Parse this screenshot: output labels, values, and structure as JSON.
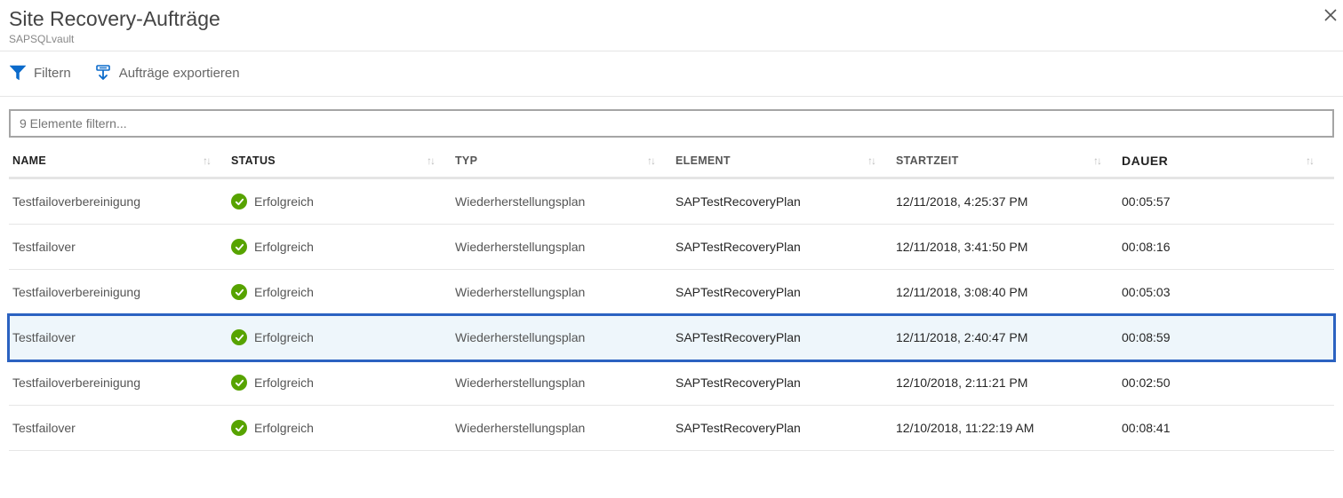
{
  "header": {
    "title": "Site Recovery-Aufträge",
    "subtitle": "SAPSQLvault"
  },
  "toolbar": {
    "filter_label": "Filtern",
    "export_label": "Aufträge exportieren"
  },
  "filter": {
    "placeholder": "9 Elemente filtern..."
  },
  "columns": {
    "name": "NAME",
    "status": "STATUS",
    "typ": "TYP",
    "element": "ELEMENT",
    "start": "STARTZEIT",
    "dauer": "DAUER"
  },
  "rows": [
    {
      "name": "Testfailoverbereinigung",
      "status": "Erfolgreich",
      "typ": "Wiederherstellungsplan",
      "element": "SAPTestRecoveryPlan",
      "start": "12/11/2018, 4:25:37 PM",
      "dauer": "00:05:57",
      "selected": false
    },
    {
      "name": "Testfailover",
      "status": "Erfolgreich",
      "typ": "Wiederherstellungsplan",
      "element": "SAPTestRecoveryPlan",
      "start": "12/11/2018, 3:41:50 PM",
      "dauer": "00:08:16",
      "selected": false
    },
    {
      "name": "Testfailoverbereinigung",
      "status": "Erfolgreich",
      "typ": "Wiederherstellungsplan",
      "element": "SAPTestRecoveryPlan",
      "start": "12/11/2018, 3:08:40 PM",
      "dauer": "00:05:03",
      "selected": false
    },
    {
      "name": "Testfailover",
      "status": "Erfolgreich",
      "typ": "Wiederherstellungsplan",
      "element": "SAPTestRecoveryPlan",
      "start": "12/11/2018, 2:40:47 PM",
      "dauer": "00:08:59",
      "selected": true
    },
    {
      "name": "Testfailoverbereinigung",
      "status": "Erfolgreich",
      "typ": "Wiederherstellungsplan",
      "element": "SAPTestRecoveryPlan",
      "start": "12/10/2018, 2:11:21 PM",
      "dauer": "00:02:50",
      "selected": false
    },
    {
      "name": "Testfailover",
      "status": "Erfolgreich",
      "typ": "Wiederherstellungsplan",
      "element": "SAPTestRecoveryPlan",
      "start": "12/10/2018, 11:22:19 AM",
      "dauer": "00:08:41",
      "selected": false
    }
  ]
}
